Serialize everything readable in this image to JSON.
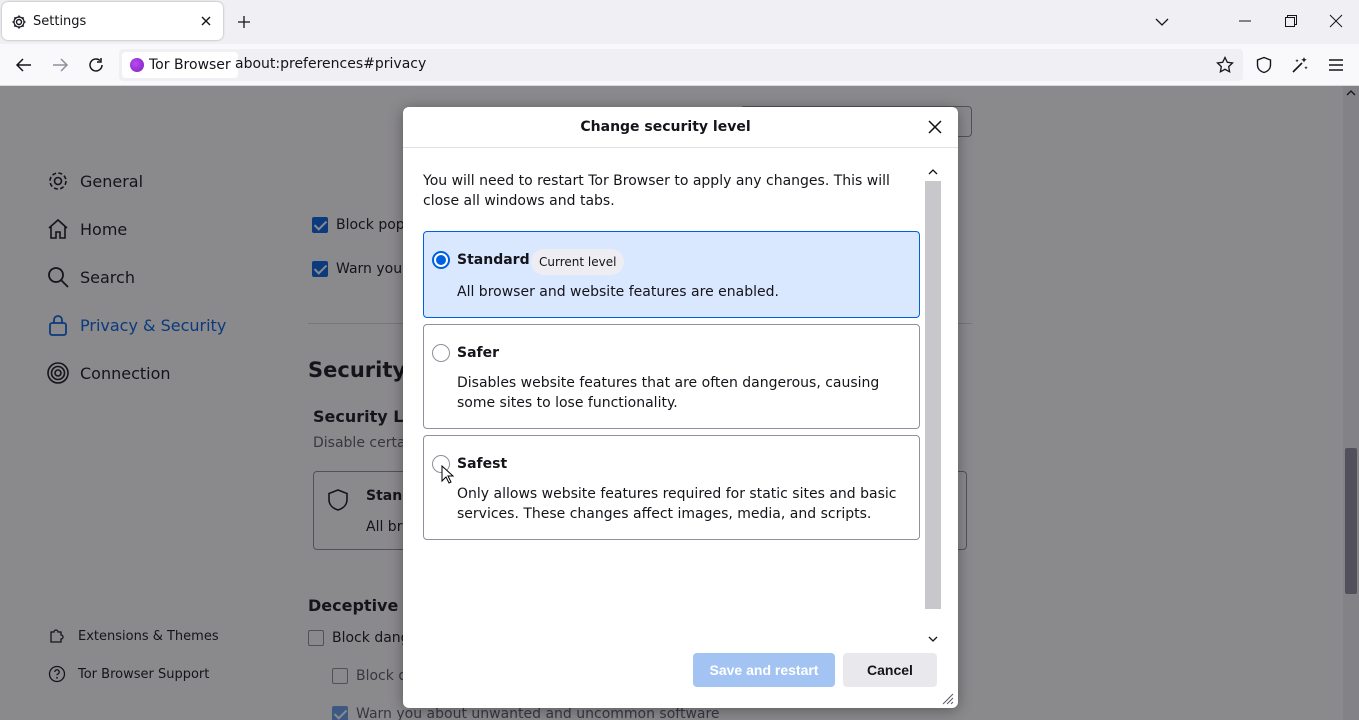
{
  "tab": {
    "title": "Settings"
  },
  "navbar": {
    "identity_label": "Tor Browser",
    "url": "about:preferences#privacy"
  },
  "sidebar": {
    "categories": [
      {
        "label": "General",
        "icon": "gear-icon"
      },
      {
        "label": "Home",
        "icon": "home-icon"
      },
      {
        "label": "Search",
        "icon": "search-icon"
      },
      {
        "label": "Privacy & Security",
        "icon": "lock-icon",
        "selected": true
      },
      {
        "label": "Connection",
        "icon": "onion-icon"
      }
    ],
    "footer": [
      {
        "label": "Extensions & Themes",
        "icon": "puzzle-icon"
      },
      {
        "label": "Tor Browser Support",
        "icon": "help-icon"
      }
    ]
  },
  "page": {
    "block_popups": "Block pop",
    "warn_addons": "Warn you",
    "security_heading": "Security",
    "security_level_heading": "Security Lev",
    "security_level_desc": "Disable certai",
    "standard_card_title": "Stand",
    "standard_card_desc": "All br",
    "deceptive_heading": "Deceptive Co",
    "block_dangerous": "Block dang",
    "block_downloads": "Block d",
    "warn_unwanted": "Warn you about unwanted and uncommon software"
  },
  "dialog": {
    "title": "Change security level",
    "description": "You will need to restart Tor Browser to apply any changes. This will close all windows and tabs.",
    "options": [
      {
        "name": "Standard",
        "badge": "Current level",
        "desc": "All browser and website features are enabled.",
        "selected": true
      },
      {
        "name": "Safer",
        "desc": "Disables website features that are often dangerous, causing some sites to lose functionality.",
        "selected": false
      },
      {
        "name": "Safest",
        "desc": "Only allows website features required for static sites and basic services. These changes affect images, media, and scripts.",
        "selected": false
      }
    ],
    "save_label": "Save and restart",
    "cancel_label": "Cancel"
  },
  "colors": {
    "accent": "#0061e0",
    "selected_bg": "#d9e7ff",
    "disabled_primary": "#a3c4f3"
  }
}
